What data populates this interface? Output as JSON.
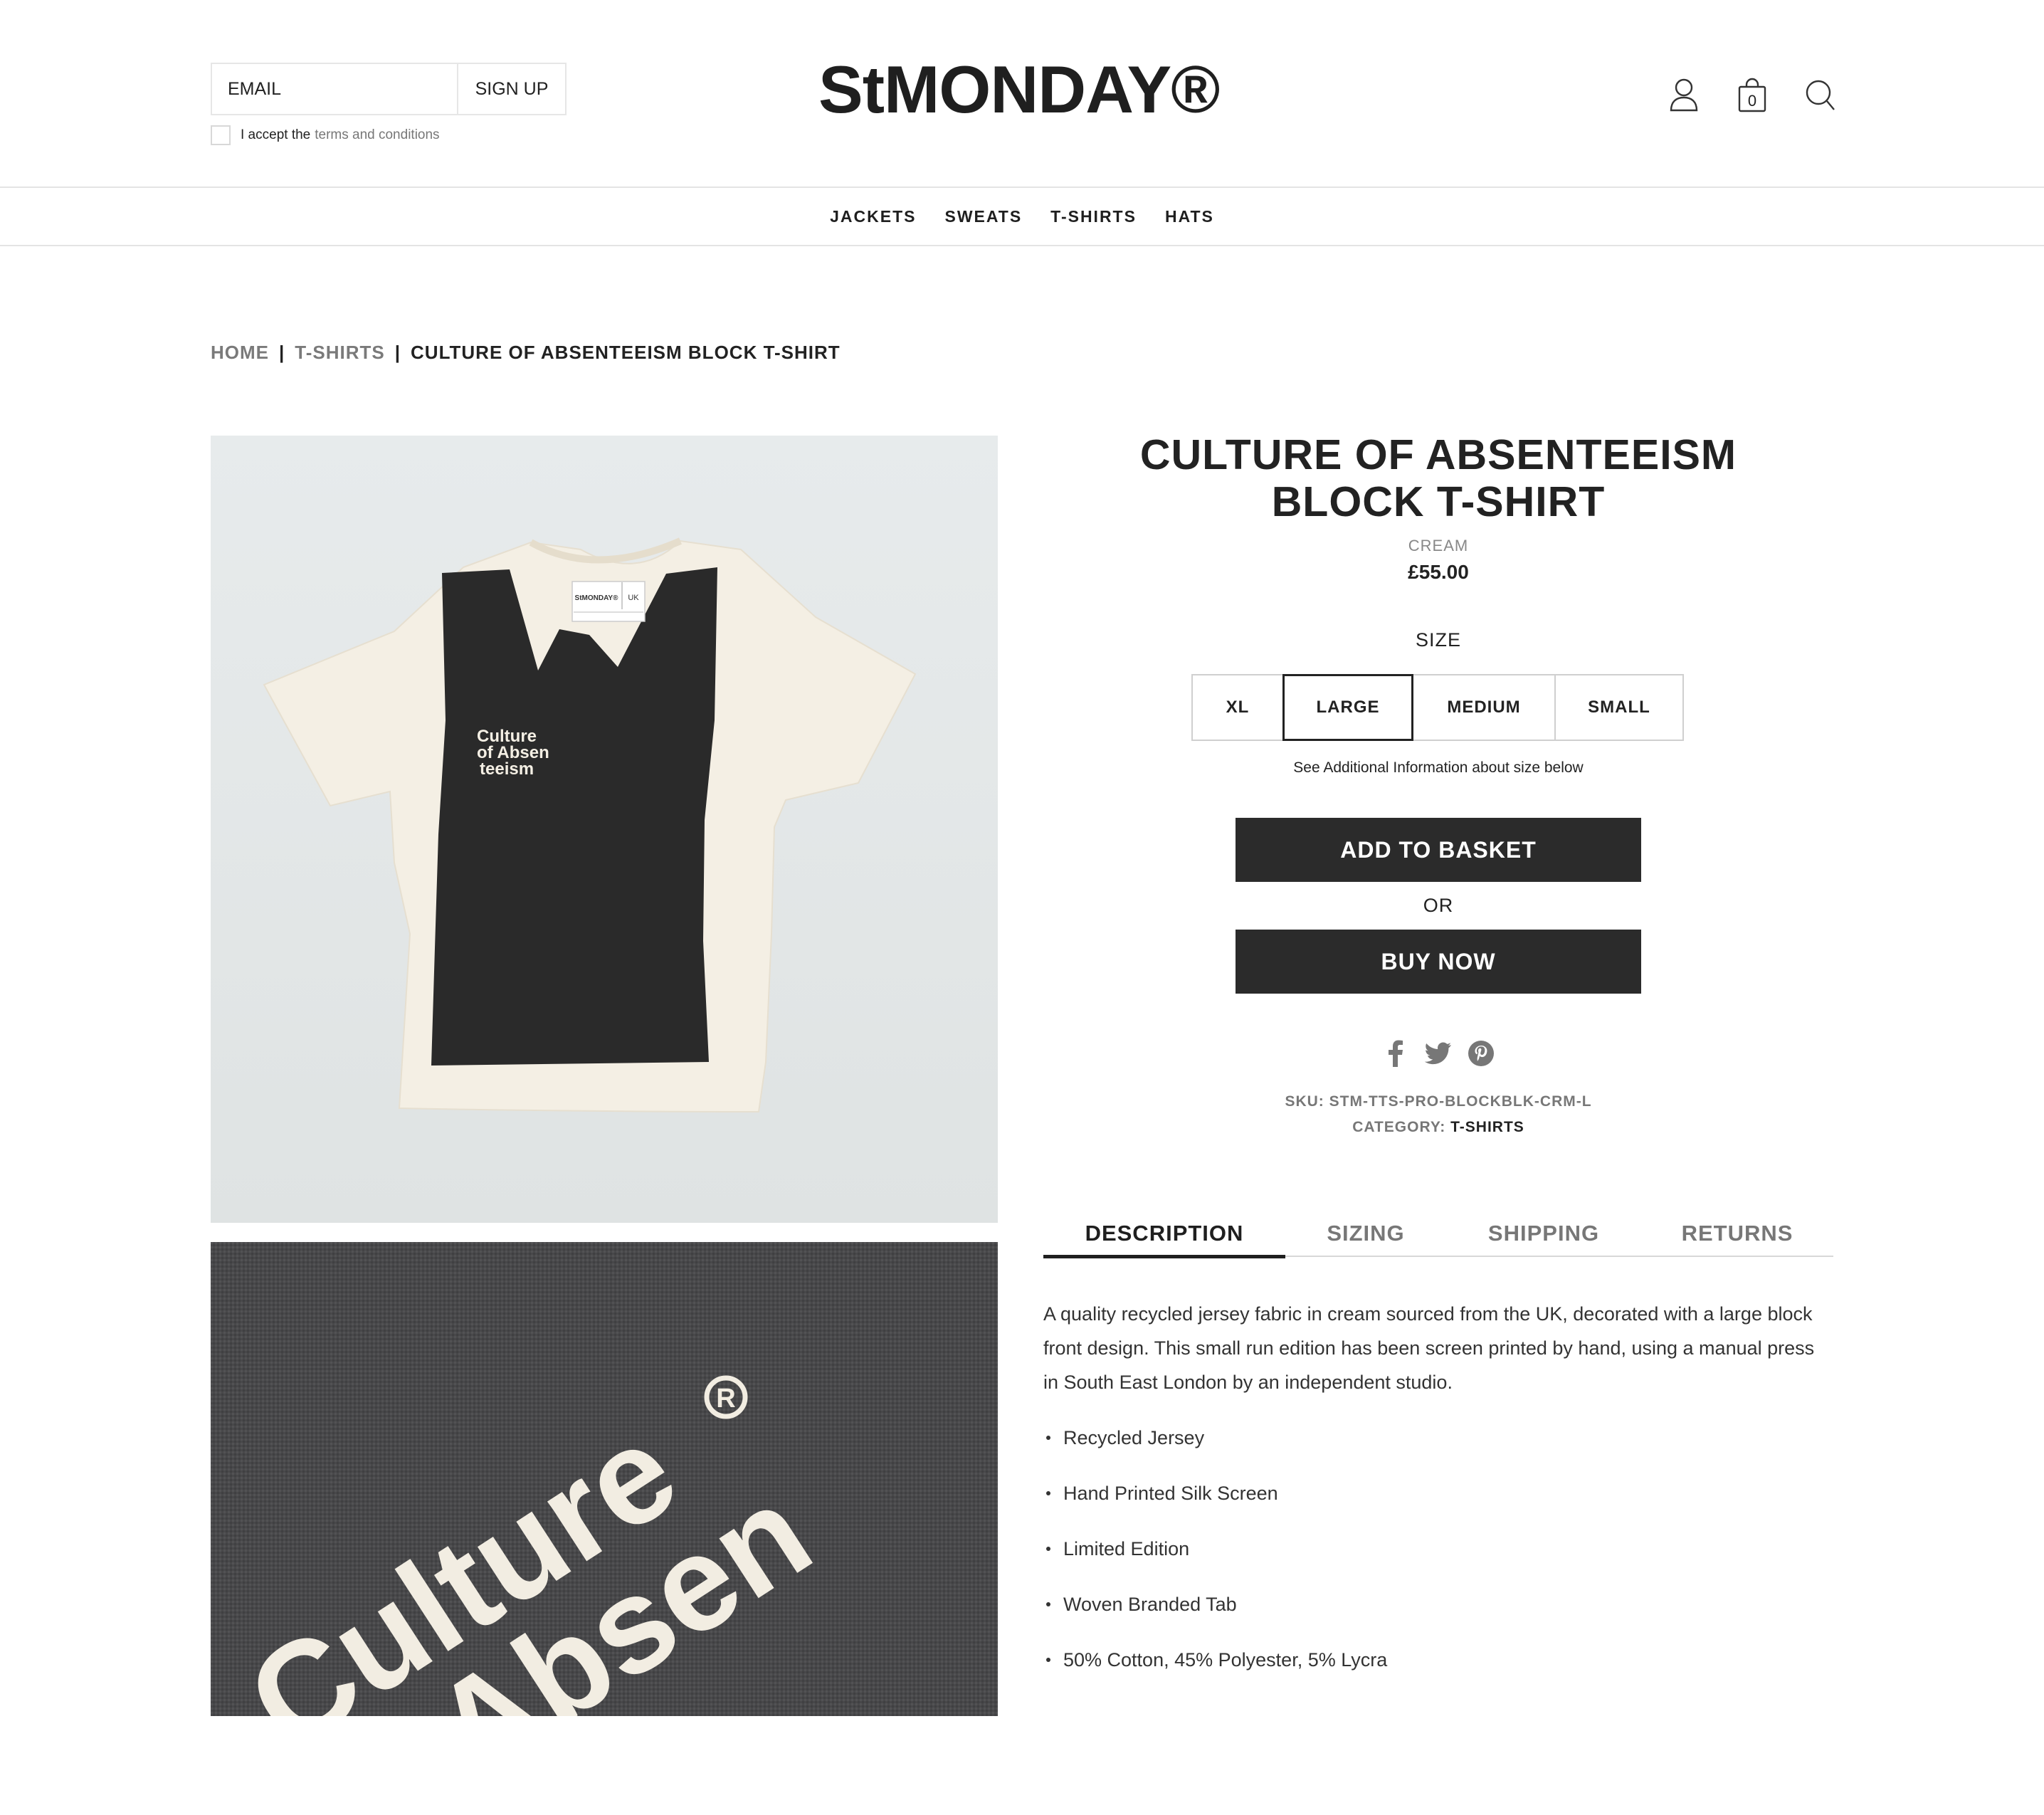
{
  "header": {
    "email_placeholder": "EMAIL",
    "signup_label": "SIGN UP",
    "terms_prefix": "I accept the",
    "terms_link": "terms and conditions",
    "logo": "StMONDAY®",
    "basket_count": "0"
  },
  "nav": {
    "items": [
      "JACKETS",
      "SWEATS",
      "T-SHIRTS",
      "HATS"
    ]
  },
  "breadcrumb": {
    "home": "HOME",
    "category": "T-SHIRTS",
    "current": "CULTURE OF ABSENTEEISM BLOCK T-SHIRT"
  },
  "product": {
    "title_line1": "CULTURE OF ABSENTEEISM",
    "title_line2": "BLOCK T-SHIRT",
    "color": "CREAM",
    "price": "£55.00",
    "size_label": "SIZE",
    "sizes": [
      "XL",
      "LARGE",
      "MEDIUM",
      "SMALL"
    ],
    "selected_size": "LARGE",
    "size_note": "See Additional Information about size below",
    "add_to_basket": "ADD TO BASKET",
    "or": "OR",
    "buy_now": "BUY NOW",
    "sku_label": "SKU:",
    "sku": "STM-TTS-PRO-BLOCKBLK-CRM-L",
    "category_label": "CATEGORY:",
    "category": "T-SHIRTS"
  },
  "images": {
    "print_line1": "Culture",
    "print_line2": "of Absen",
    "print_line3": "teeism",
    "tag_brand": "StMONDAY®",
    "tag_country": "UK"
  },
  "tabs": [
    "DESCRIPTION",
    "SIZING",
    "SHIPPING",
    "RETURNS"
  ],
  "description": {
    "text": "A quality recycled jersey fabric in cream sourced from the UK, decorated with a large block front design. This small run edition has been screen printed by hand, using a manual press in South East London by an independent studio.",
    "bullets": [
      "Recycled Jersey",
      "Hand Printed Silk Screen",
      "Limited Edition",
      "Woven Branded Tab",
      "50% Cotton, 45% Polyester, 5% Lycra"
    ]
  },
  "colors": {
    "button_bg": "#2b2b2b",
    "text": "#222222",
    "muted": "#777777",
    "shirt": "#f4efe4",
    "print": "#2a2a2a"
  },
  "icons": [
    "account-icon",
    "basket-icon",
    "search-icon",
    "facebook-icon",
    "twitter-icon",
    "pinterest-icon"
  ]
}
